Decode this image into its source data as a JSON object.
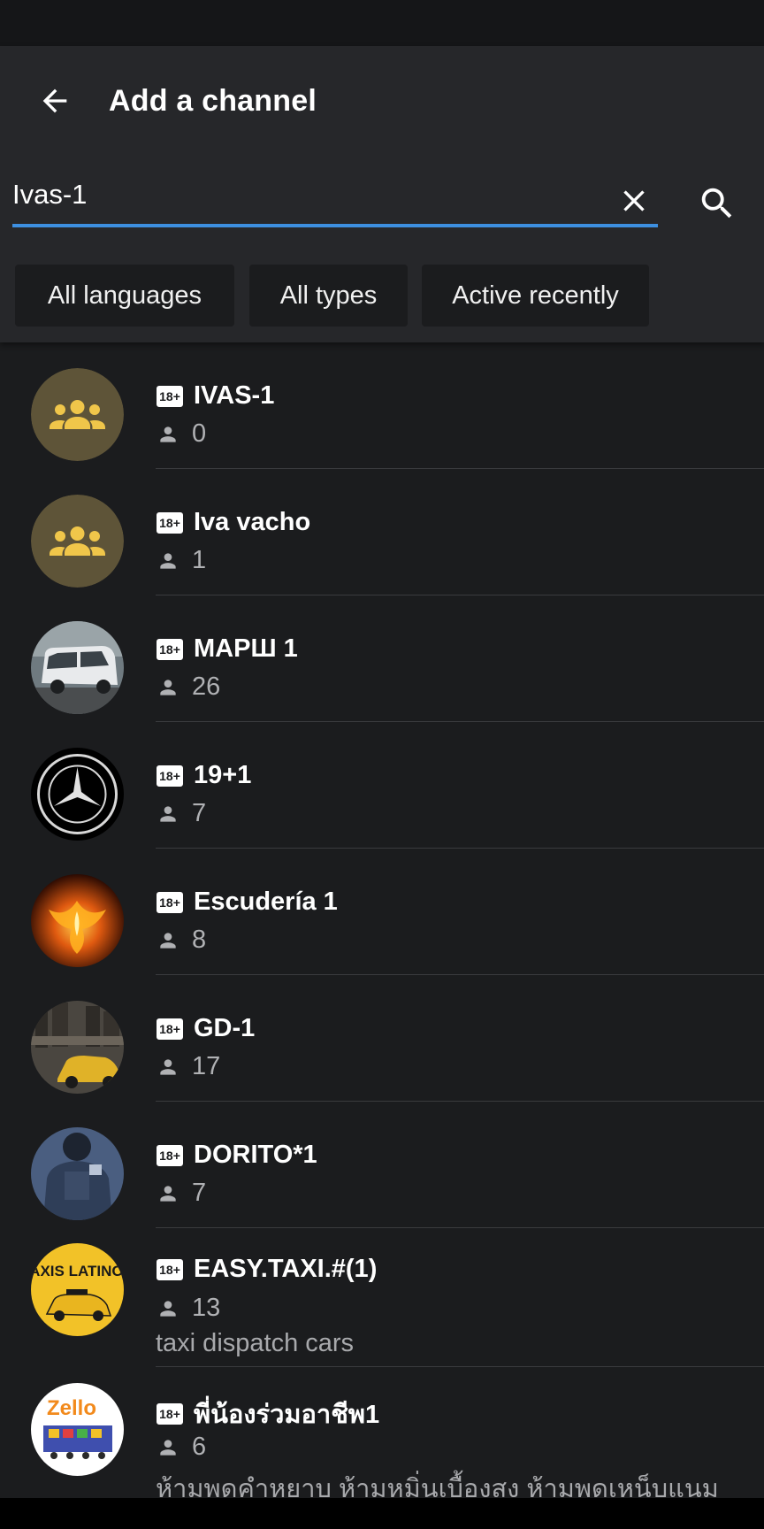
{
  "header": {
    "title": "Add a channel",
    "back_icon": "arrow-back-icon",
    "clear_icon": "close-icon",
    "search_icon": "search-icon",
    "accent_color": "#3d8fe0"
  },
  "search": {
    "value": "Ivas-1"
  },
  "filters": [
    {
      "label": "All languages"
    },
    {
      "label": "All types"
    },
    {
      "label": "Active recently"
    }
  ],
  "channels": [
    {
      "badge": "18+",
      "name": "IVAS-1",
      "count": "0",
      "avatar": "group-icon"
    },
    {
      "badge": "18+",
      "name": "Iva vacho",
      "count": "1",
      "avatar": "group-icon"
    },
    {
      "badge": "18+",
      "name": "МАРШ 1",
      "count": "26",
      "avatar": "minibus-photo"
    },
    {
      "badge": "18+",
      "name": "19+1",
      "count": "7",
      "avatar": "mercedes-benz-logo"
    },
    {
      "badge": "18+",
      "name": "Escudería 1",
      "count": "8",
      "avatar": "phoenix-fire-image"
    },
    {
      "badge": "18+",
      "name": "GD-1",
      "count": "17",
      "avatar": "city-taxi-image"
    },
    {
      "badge": "18+",
      "name": "DORITO*1",
      "count": "7",
      "avatar": "soldier-photo"
    },
    {
      "badge": "18+",
      "name": "EASY.TAXI.#(1)",
      "count": "13",
      "description": "taxi dispatch cars",
      "avatar": "taxis-latinos-logo",
      "avatar_text": "TAXIS LATINOS"
    },
    {
      "badge": "18+",
      "name": "พี่น้องร่วมอาชีพ1",
      "count": "6",
      "description": "ห้ามพดคำหยาบ ห้ามหมิ่นเบื้องสง ห้ามพดเหน็บแนม",
      "avatar": "zello-logo",
      "avatar_text": "Zello"
    }
  ]
}
